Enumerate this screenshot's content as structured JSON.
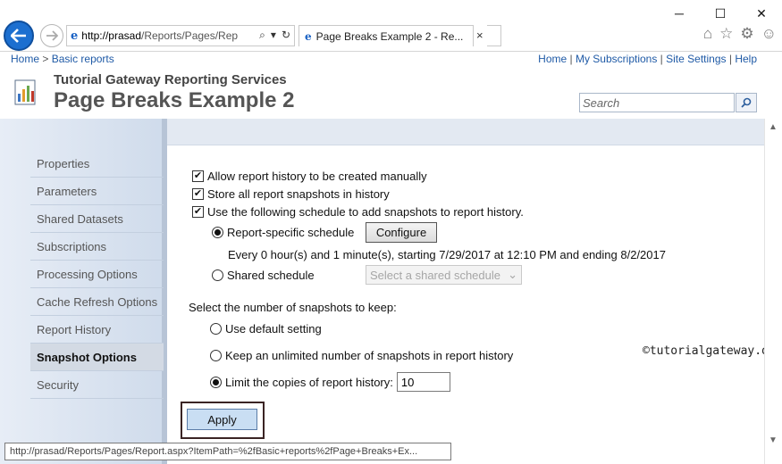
{
  "browser": {
    "address_host": "http://prasad",
    "address_rest": "/Reports/Pages/Rep",
    "tab_title": "Page Breaks Example 2 - Re...",
    "tab_close": "×",
    "window_controls": [
      "─",
      "☐",
      "✕"
    ],
    "status_url": "http://prasad/Reports/Pages/Report.aspx?ItemPath=%2fBasic+reports%2fPage+Breaks+Ex..."
  },
  "breadcrumb": {
    "home": "Home",
    "separator": ">",
    "folder": "Basic reports"
  },
  "top_links": [
    "Home",
    "My Subscriptions",
    "Site Settings",
    "Help"
  ],
  "header": {
    "site_title": "Tutorial Gateway Reporting Services",
    "page_title": "Page Breaks Example 2",
    "search_placeholder": "Search"
  },
  "sidebar": {
    "items": [
      {
        "label": "Properties",
        "active": false
      },
      {
        "label": "Parameters",
        "active": false
      },
      {
        "label": "Shared Datasets",
        "active": false
      },
      {
        "label": "Subscriptions",
        "active": false
      },
      {
        "label": "Processing Options",
        "active": false
      },
      {
        "label": "Cache Refresh Options",
        "active": false
      },
      {
        "label": "Report History",
        "active": false
      },
      {
        "label": "Snapshot Options",
        "active": true
      },
      {
        "label": "Security",
        "active": false
      }
    ]
  },
  "options": {
    "allow_manual": {
      "label": "Allow report history to be created manually",
      "checked": true
    },
    "store_snapshots": {
      "label": "Store all report snapshots in history",
      "checked": true
    },
    "use_schedule": {
      "label": "Use the following schedule to add snapshots to report history.",
      "checked": true
    },
    "report_specific": {
      "label": "Report-specific schedule",
      "selected": true
    },
    "configure_label": "Configure",
    "schedule_desc": "Every 0 hour(s) and 1 minute(s), starting 7/29/2017 at 12:10 PM and ending 8/2/2017",
    "shared_schedule": {
      "label": "Shared schedule",
      "selected": false
    },
    "shared_select": "Select a shared schedule",
    "keep_heading": "Select the number of snapshots to keep:",
    "use_default": {
      "label": "Use default setting",
      "selected": false
    },
    "unlimited": {
      "label": "Keep an unlimited number of snapshots in report history",
      "selected": false
    },
    "limit": {
      "label": "Limit the copies of report history:",
      "selected": true
    },
    "limit_value": "10",
    "apply_label": "Apply"
  },
  "watermark": "©tutorialgateway.org"
}
